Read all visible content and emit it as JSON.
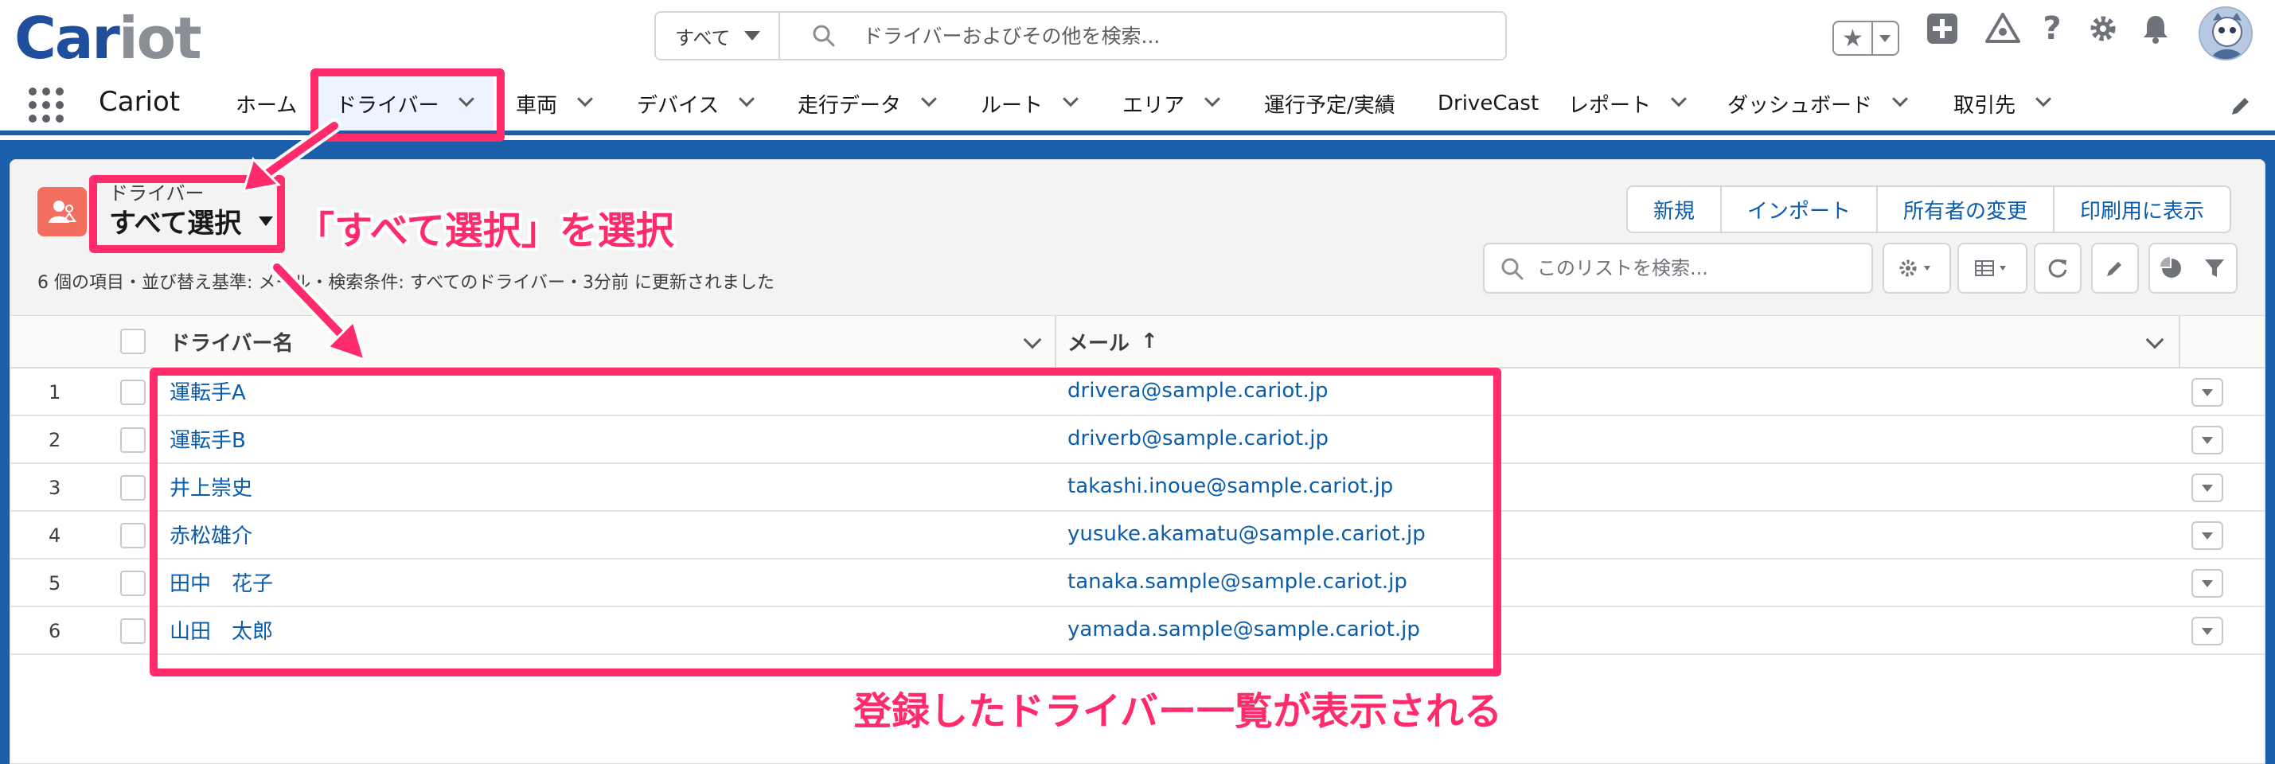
{
  "header": {
    "logo": {
      "part1": "Car",
      "part2": "iot"
    },
    "search_scope": "すべて",
    "search_placeholder": "ドライバーおよびその他を検索..."
  },
  "nav": {
    "app_name": "Cariot",
    "items": [
      {
        "label": "ホーム"
      },
      {
        "label": "ドライバー"
      },
      {
        "label": "車両"
      },
      {
        "label": "デバイス"
      },
      {
        "label": "走行データ"
      },
      {
        "label": "ルート"
      },
      {
        "label": "エリア"
      },
      {
        "label": "運行予定/実績"
      },
      {
        "label": "DriveCast"
      },
      {
        "label": "レポート"
      },
      {
        "label": "ダッシュボード"
      },
      {
        "label": "取引先"
      }
    ]
  },
  "list": {
    "object_label": "ドライバー",
    "view_name": "すべて選択",
    "meta": "6 個の項目・並び替え基準: メール・検索条件: すべてのドライバー・3分前 に更新されました",
    "actions": [
      "新規",
      "インポート",
      "所有者の変更",
      "印刷用に表示"
    ],
    "search_placeholder": "このリストを検索...",
    "columns": {
      "name": "ドライバー名",
      "email": "メール",
      "sort_arrow": "↑"
    },
    "rows": [
      {
        "num": "1",
        "name": "運転手A",
        "email": "drivera@sample.cariot.jp"
      },
      {
        "num": "2",
        "name": "運転手B",
        "email": "driverb@sample.cariot.jp"
      },
      {
        "num": "3",
        "name": "井上崇史",
        "email": "takashi.inoue@sample.cariot.jp"
      },
      {
        "num": "4",
        "name": "赤松雄介",
        "email": "yusuke.akamatu@sample.cariot.jp"
      },
      {
        "num": "5",
        "name": "田中　花子",
        "email": "tanaka.sample@sample.cariot.jp"
      },
      {
        "num": "6",
        "name": "山田　太郎",
        "email": "yamada.sample@sample.cariot.jp"
      }
    ]
  },
  "annotations": {
    "select_all": "「すべて選択」を選択",
    "driver_list": "登録したドライバー一覧が表示される",
    "color": "#ff2b6b"
  },
  "colors": {
    "brand": "#1f4e9c",
    "nav_border": "#1b5faa",
    "link": "#0b5cab",
    "object_icon": "#f26f5f"
  }
}
